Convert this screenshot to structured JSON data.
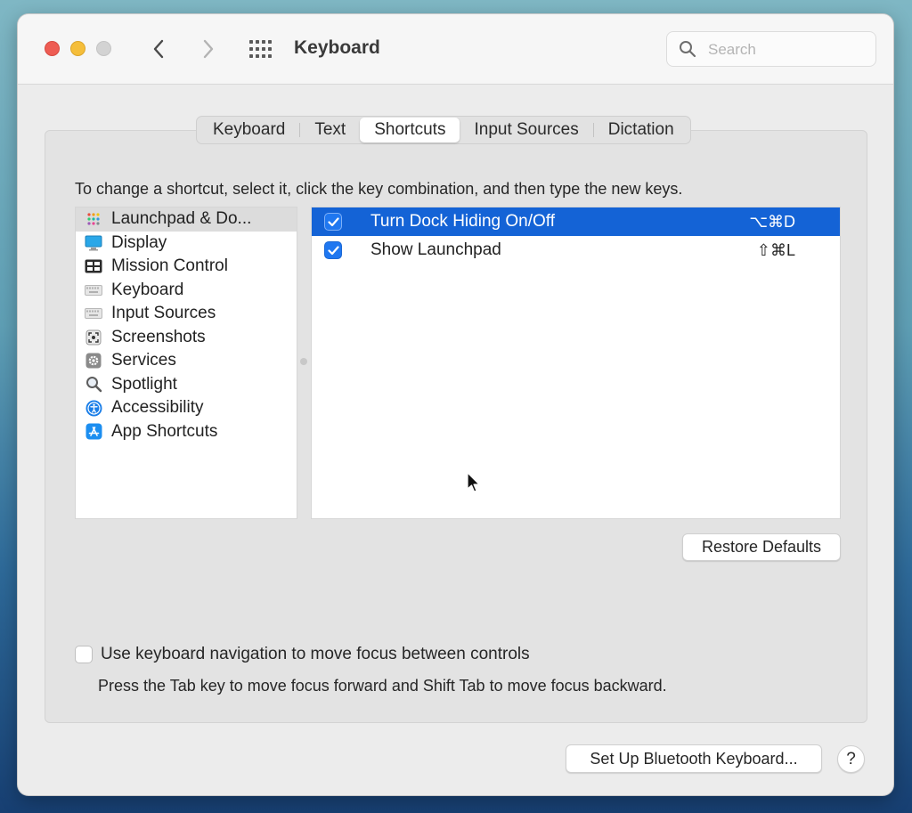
{
  "window": {
    "title": "Keyboard",
    "search": {
      "placeholder": "Search",
      "value": ""
    }
  },
  "tabs": [
    {
      "label": "Keyboard",
      "active": false
    },
    {
      "label": "Text",
      "active": false
    },
    {
      "label": "Shortcuts",
      "active": true
    },
    {
      "label": "Input Sources",
      "active": false
    },
    {
      "label": "Dictation",
      "active": false
    }
  ],
  "instruction": "To change a shortcut, select it, click the key combination, and then type the new keys.",
  "categories": [
    {
      "label": "Launchpad & Do...",
      "icon": "launchpad-icon",
      "selected": true
    },
    {
      "label": "Display",
      "icon": "display-icon",
      "selected": false
    },
    {
      "label": "Mission Control",
      "icon": "mission-control-icon",
      "selected": false
    },
    {
      "label": "Keyboard",
      "icon": "keyboard-icon",
      "selected": false
    },
    {
      "label": "Input Sources",
      "icon": "input-sources-icon",
      "selected": false
    },
    {
      "label": "Screenshots",
      "icon": "screenshots-icon",
      "selected": false
    },
    {
      "label": "Services",
      "icon": "services-icon",
      "selected": false
    },
    {
      "label": "Spotlight",
      "icon": "spotlight-icon",
      "selected": false
    },
    {
      "label": "Accessibility",
      "icon": "accessibility-icon",
      "selected": false
    },
    {
      "label": "App Shortcuts",
      "icon": "app-shortcuts-icon",
      "selected": false
    }
  ],
  "shortcuts": [
    {
      "label": "Turn Dock Hiding On/Off",
      "keys": "⌥⌘D",
      "checked": true,
      "selected": true
    },
    {
      "label": "Show Launchpad",
      "keys": "⇧⌘L",
      "checked": true,
      "selected": false
    }
  ],
  "buttons": {
    "restore_defaults": "Restore Defaults",
    "bluetooth": "Set Up Bluetooth Keyboard...",
    "help": "?"
  },
  "keyboard_navigation": {
    "label": "Use keyboard navigation to move focus between controls",
    "checked": false,
    "help": "Press the Tab key to move focus forward and Shift Tab to move focus backward."
  },
  "colors": {
    "selection": "#1463d6",
    "checkbox": "#1f77f0",
    "close": "#ee5c53",
    "minimize": "#f5be3a"
  }
}
